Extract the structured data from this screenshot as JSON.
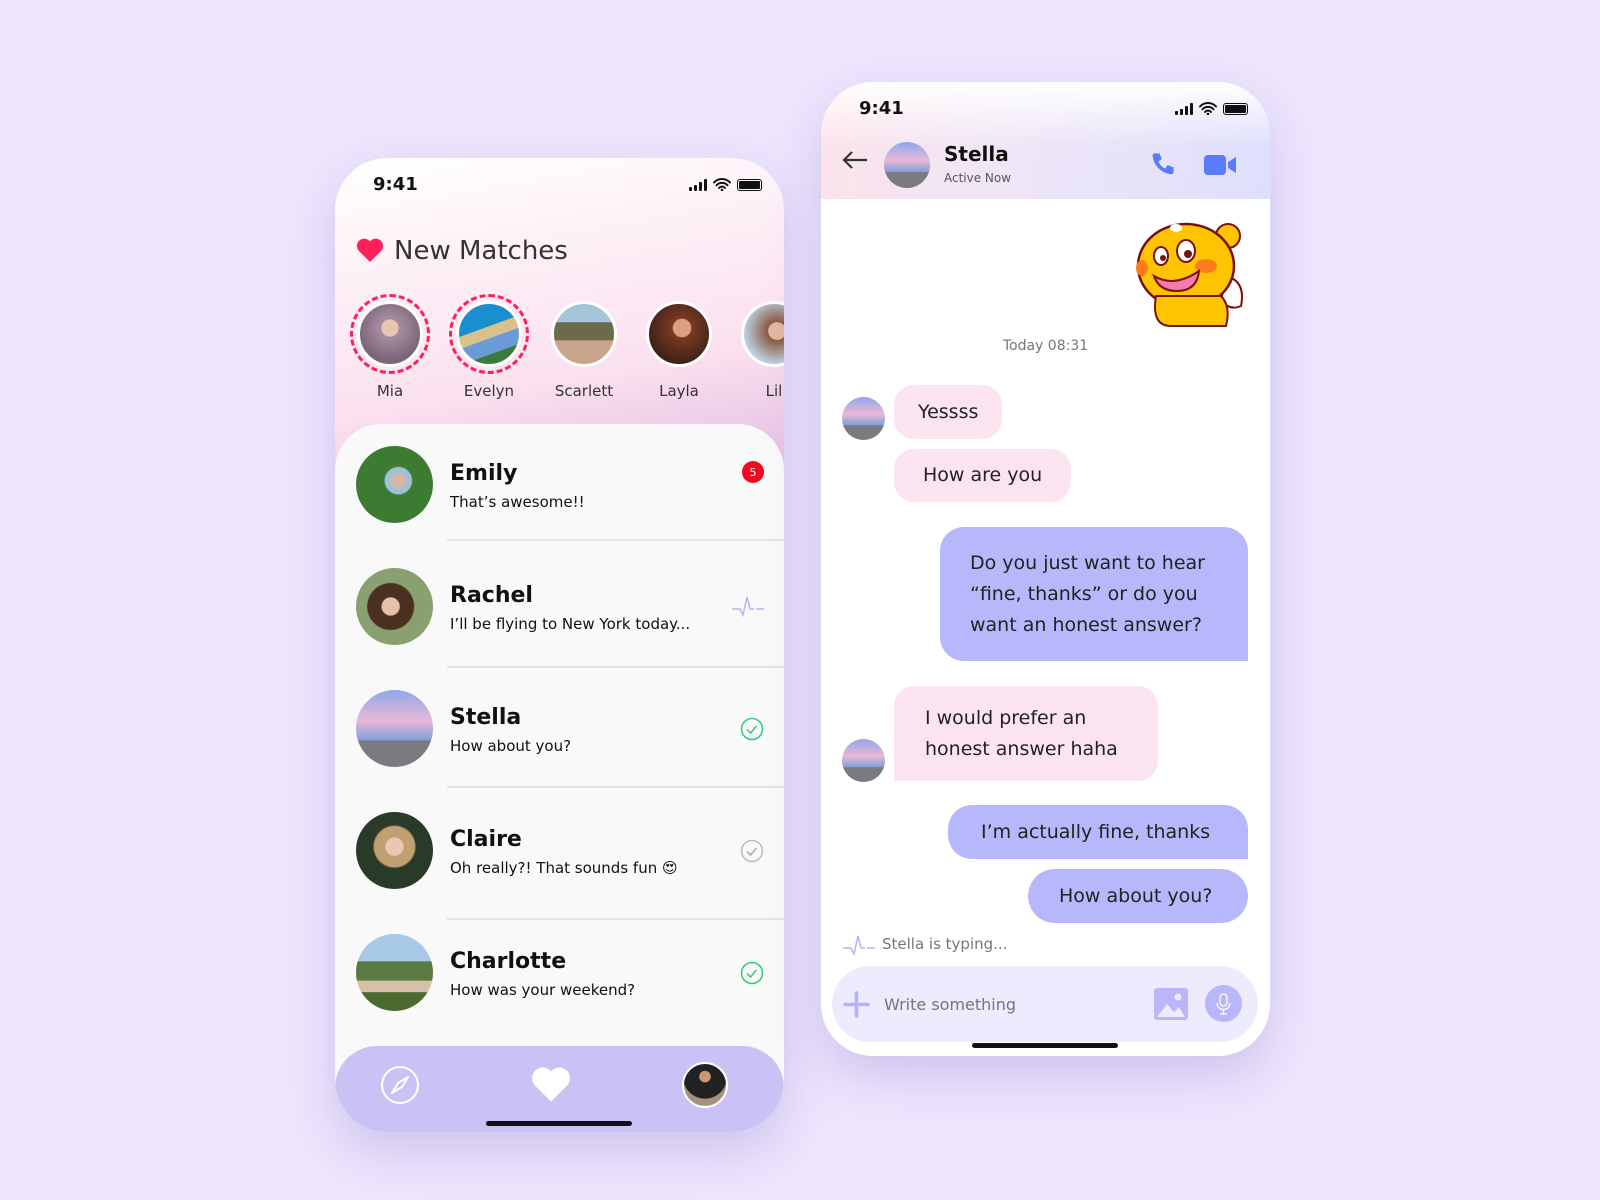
{
  "status_bar": {
    "time": "9:41"
  },
  "matches_screen": {
    "title": "New Matches",
    "stories": [
      {
        "name": "Mia",
        "is_new": true
      },
      {
        "name": "Evelyn",
        "is_new": true
      },
      {
        "name": "Scarlett",
        "is_new": false
      },
      {
        "name": "Layla",
        "is_new": false
      },
      {
        "name": "Lil",
        "is_new": false
      }
    ],
    "conversations": [
      {
        "name": "Emily",
        "message": "That’s awesome!!",
        "status": "unread",
        "badge": "5"
      },
      {
        "name": "Rachel",
        "message": "I’ll be flying to New York today...",
        "status": "typing"
      },
      {
        "name": "Stella",
        "message": "How about you?",
        "status": "read"
      },
      {
        "name": "Claire",
        "message": "Oh really?! That sounds fun 😍",
        "status": "sent"
      },
      {
        "name": "Charlotte",
        "message": "How was your weekend?",
        "status": "read"
      }
    ],
    "nav": [
      "compass-icon",
      "heart-icon",
      "profile-avatar"
    ]
  },
  "chat_screen": {
    "contact_name": "Stella",
    "contact_status": "Active Now",
    "timestamp": "Today 08:31",
    "messages": [
      {
        "from": "them",
        "text": "Yessss"
      },
      {
        "from": "them",
        "text": "How are you"
      },
      {
        "from": "me",
        "text": "Do you just want to hear “fine, thanks” or do you want an honest answer?"
      },
      {
        "from": "them",
        "text": "I would prefer an honest answer haha"
      },
      {
        "from": "me",
        "text": "I’m actually fine, thanks"
      },
      {
        "from": "me",
        "text": "How about you?"
      }
    ],
    "typing_indicator": "Stella is typing...",
    "input_placeholder": "Write something"
  },
  "colors": {
    "background": "#ede6fd",
    "accent_pink": "#ff1f5a",
    "bubble_them": "#fbe4f0",
    "bubble_me": "#b7b7fb",
    "nav": "#c9c3f5",
    "call_icon": "#5b7cfa",
    "badge": "#f00a1f",
    "read_check": "#2ecc71"
  }
}
